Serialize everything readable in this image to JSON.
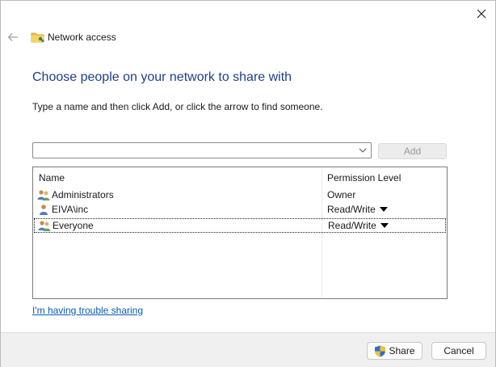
{
  "window": {
    "title": "Network access",
    "close_glyph": "✕",
    "back_glyph": "←"
  },
  "heading": "Choose people on your network to share with",
  "instruction": "Type a name and then click Add, or click the arrow to find someone.",
  "name_input": {
    "value": "",
    "placeholder": ""
  },
  "add_button": "Add",
  "table": {
    "columns": [
      "Name",
      "Permission Level"
    ],
    "rows": [
      {
        "name": "Administrators",
        "permission": "Owner",
        "has_dropdown": false,
        "icon": "group-icon"
      },
      {
        "name": "EIVA\\inc",
        "permission": "Read/Write",
        "has_dropdown": true,
        "icon": "user-icon"
      },
      {
        "name": "Everyone",
        "permission": "Read/Write",
        "has_dropdown": true,
        "icon": "group-icon",
        "selected": true
      }
    ]
  },
  "trouble_link": "I'm having trouble sharing",
  "footer": {
    "share_label": "Share",
    "cancel_label": "Cancel"
  },
  "colors": {
    "heading": "#1e3e8c",
    "link": "#0a5bb0",
    "footer_bg": "#f0f0f0"
  }
}
